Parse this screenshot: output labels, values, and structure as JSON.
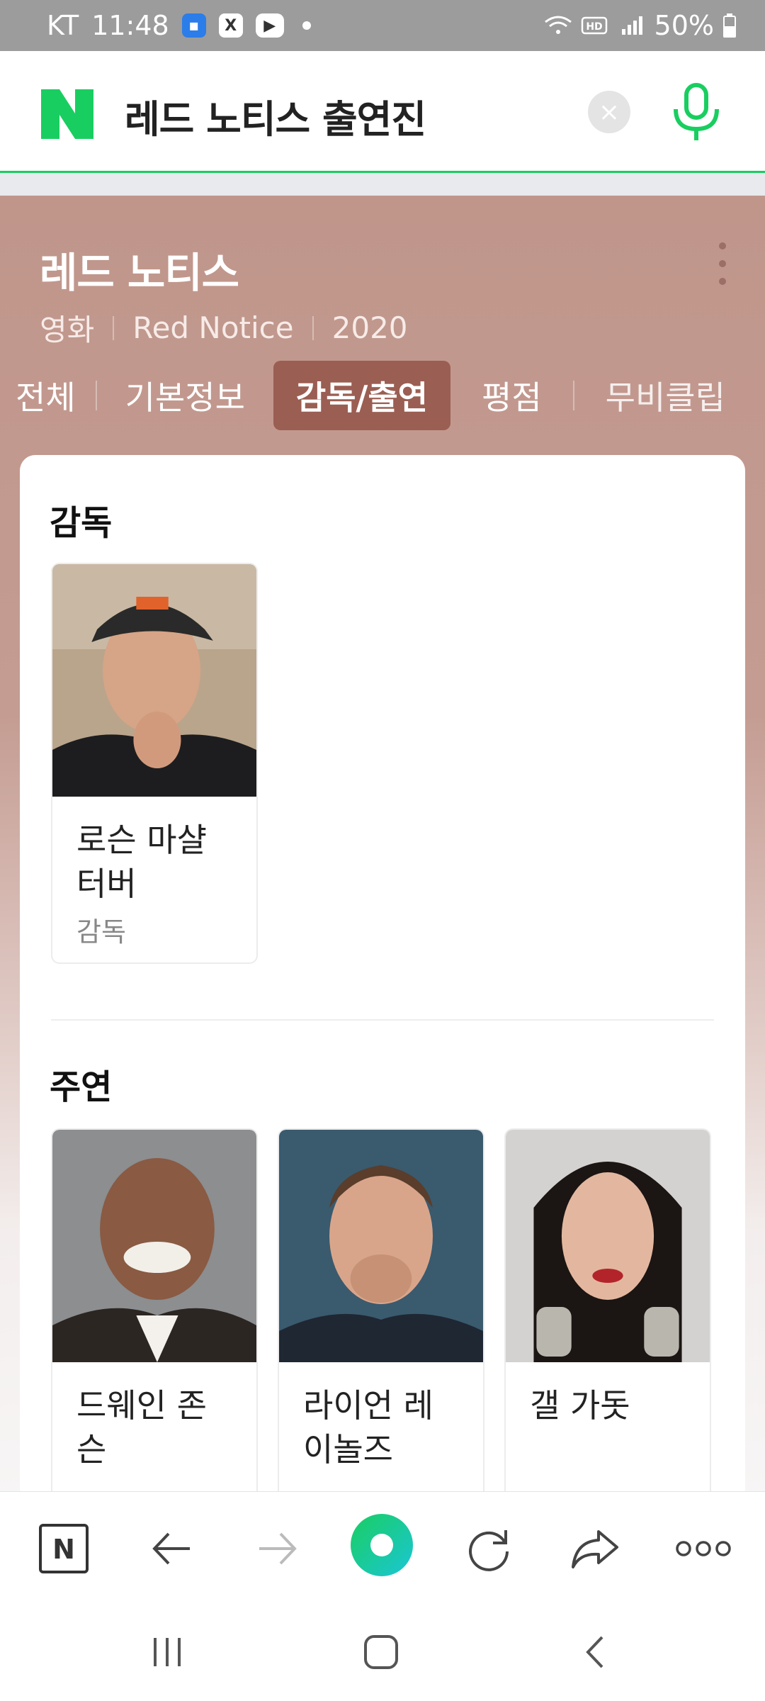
{
  "status_bar": {
    "carrier": "KT",
    "time": "11:48",
    "battery": "50%",
    "icons": [
      "folder-icon",
      "x-icon",
      "youtube-icon",
      "wifi-icon",
      "hd-icon",
      "signal-icon",
      "battery-icon"
    ]
  },
  "search": {
    "query": "레드 노티스 출연진",
    "accent_color": "#19ce60"
  },
  "movie": {
    "title": "레드 노티스",
    "category": "영화",
    "original_title": "Red Notice",
    "year": "2020"
  },
  "tabs": [
    {
      "label": "전체",
      "active": false
    },
    {
      "label": "기본정보",
      "active": false
    },
    {
      "label": "감독/출연",
      "active": true
    },
    {
      "label": "평점",
      "active": false
    },
    {
      "label": "무비클립",
      "active": false
    }
  ],
  "director_section": {
    "title": "감독",
    "people": [
      {
        "name": "로슨 마샬 터버",
        "role": "감독"
      }
    ]
  },
  "lead_section": {
    "title": "주연",
    "people": [
      {
        "name": "드웨인 존슨"
      },
      {
        "name": "라이언 레이놀즈"
      },
      {
        "name": "갤 가돗"
      }
    ]
  },
  "browser_toolbar": {
    "items": [
      "naver-home-icon",
      "back-arrow-icon",
      "forward-arrow-icon",
      "green-dot-icon",
      "refresh-icon",
      "share-icon",
      "more-icon"
    ]
  },
  "nav_bar": {
    "items": [
      "recent-apps-icon",
      "home-icon",
      "back-icon"
    ]
  }
}
